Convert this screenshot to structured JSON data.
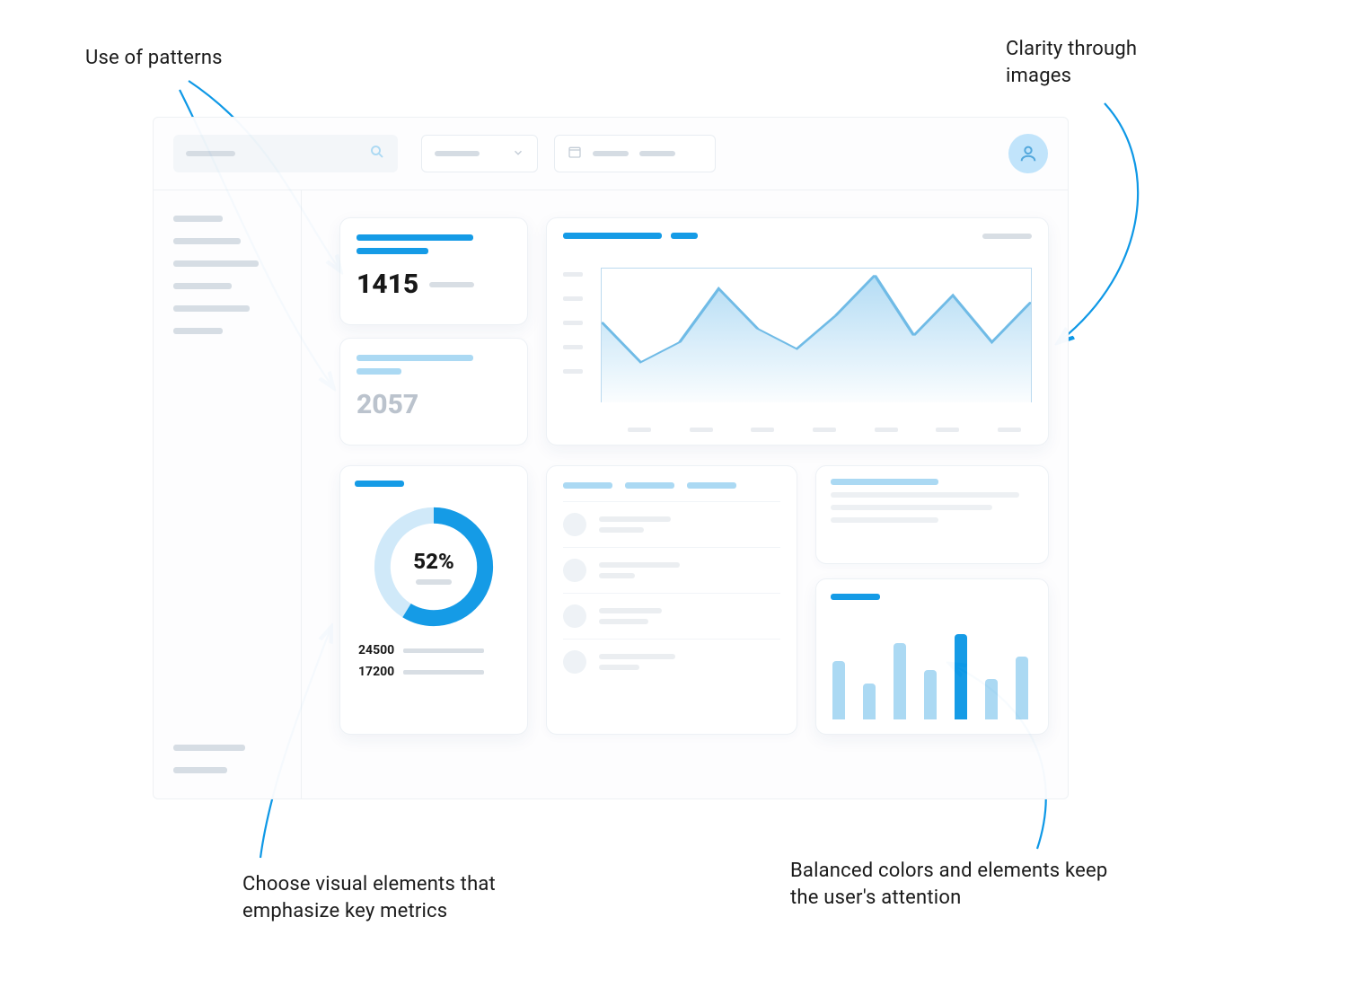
{
  "annotations": {
    "top_left": "Use of patterns",
    "top_right": "Clarity through images",
    "bottom_left": "Choose visual elements that emphasize key metrics",
    "bottom_right": "Balanced colors and elements keep the user's attention"
  },
  "colors": {
    "accent": "#0e98e6",
    "accent_light": "#a9d8f3",
    "muted": "#d7dde4"
  },
  "dashboard": {
    "topbar": {
      "search_placeholder": "",
      "dropdown_placeholder": "",
      "date_placeholder": ""
    },
    "sidebar": {
      "group1_count": 6,
      "group2_count": 2
    },
    "stat_card_primary": {
      "value": "1415"
    },
    "stat_card_secondary": {
      "value": "2057"
    },
    "donut_card": {
      "percent_label": "52%",
      "legend": [
        {
          "value": "24500"
        },
        {
          "value": "17200"
        }
      ]
    }
  },
  "chart_data": [
    {
      "type": "area",
      "title": "",
      "x": [
        0,
        1,
        2,
        3,
        4,
        5,
        6,
        7,
        8,
        9,
        10,
        11
      ],
      "values": [
        60,
        30,
        45,
        85,
        55,
        40,
        65,
        95,
        50,
        80,
        45,
        75
      ],
      "ylim": [
        0,
        100
      ],
      "x_ticks_count": 7,
      "y_ticks_count": 5
    },
    {
      "type": "pie",
      "title": "",
      "series": [
        {
          "name": "segment_a",
          "value": 24500
        },
        {
          "name": "segment_b",
          "value": 17200
        }
      ],
      "center_label": "52%"
    },
    {
      "type": "bar",
      "title": "",
      "categories": [
        "b1",
        "b2",
        "b3",
        "b4",
        "b5",
        "b6",
        "b7"
      ],
      "values": [
        65,
        40,
        85,
        55,
        95,
        45,
        70
      ],
      "highlight_index": 4,
      "ylim": [
        0,
        100
      ]
    }
  ]
}
